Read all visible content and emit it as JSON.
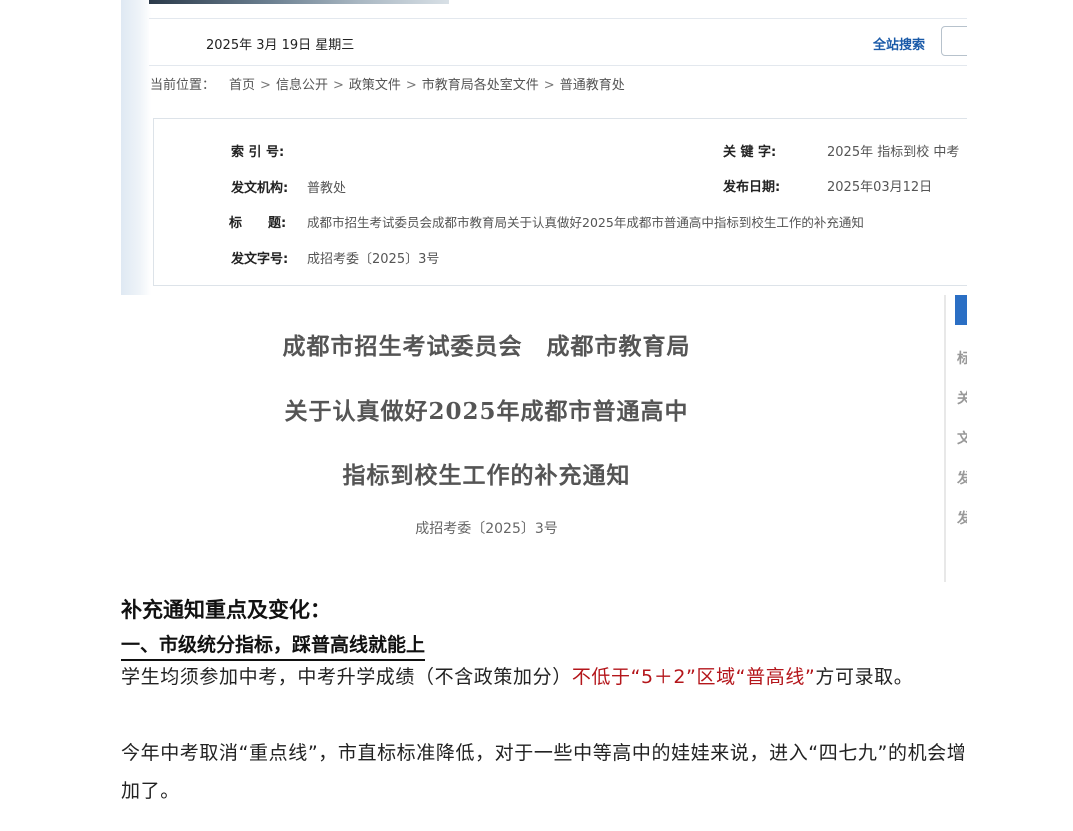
{
  "topbar": {
    "date": "2025年 3月 19日 星期三",
    "search_link": "全站搜索"
  },
  "breadcrumb": {
    "prefix": "当前位置：",
    "items": [
      "首页",
      "信息公开",
      "政策文件",
      "市教育局各处室文件",
      "普通教育处"
    ],
    "separator": ">"
  },
  "info": {
    "index_label": "索 引 号:",
    "index_value": "",
    "keyword_label": "关 键 字:",
    "keyword_value": "2025年 指标到校 中考",
    "issuer_label": "发文机构:",
    "issuer_value": "普教处",
    "date_label": "发布日期:",
    "date_value": "2025年03月12日",
    "title_label": "标　　题:",
    "title_value": "成都市招生考试委员会成都市教育局关于认真做好2025年成都市普通高中指标到校生工作的补充通知",
    "docno_label": "发文字号:",
    "docno_value": "成招考委〔2025〕3号"
  },
  "document": {
    "title_line1": "成都市招生考试委员会　成都市教育局",
    "title_line2": "关于认真做好2025年成都市普通高中",
    "title_line3": "指标到校生工作的补充通知",
    "number": "成招考委〔2025〕3号"
  },
  "sidebar_glyphs": [
    "标",
    "关",
    "文",
    "发",
    "发"
  ],
  "article": {
    "heading": "补充通知重点及变化：",
    "section1_heading": "一、市级统分指标，踩普高线就能上",
    "para1_before": "学生均须参加中考，中考升学成绩（不含政策加分）",
    "para1_highlight": "不低于“5＋2”区域“普高线”",
    "para1_after": "方可录取。",
    "para2": "今年中考取消“重点线”，市直标标准降低，对于一些中等高中的娃娃来说，进入“四七九”的机会增加了。"
  },
  "colors": {
    "link_blue": "#1a5aa8",
    "highlight_red": "#b4161b",
    "tab_blue": "#2b6fc4"
  }
}
